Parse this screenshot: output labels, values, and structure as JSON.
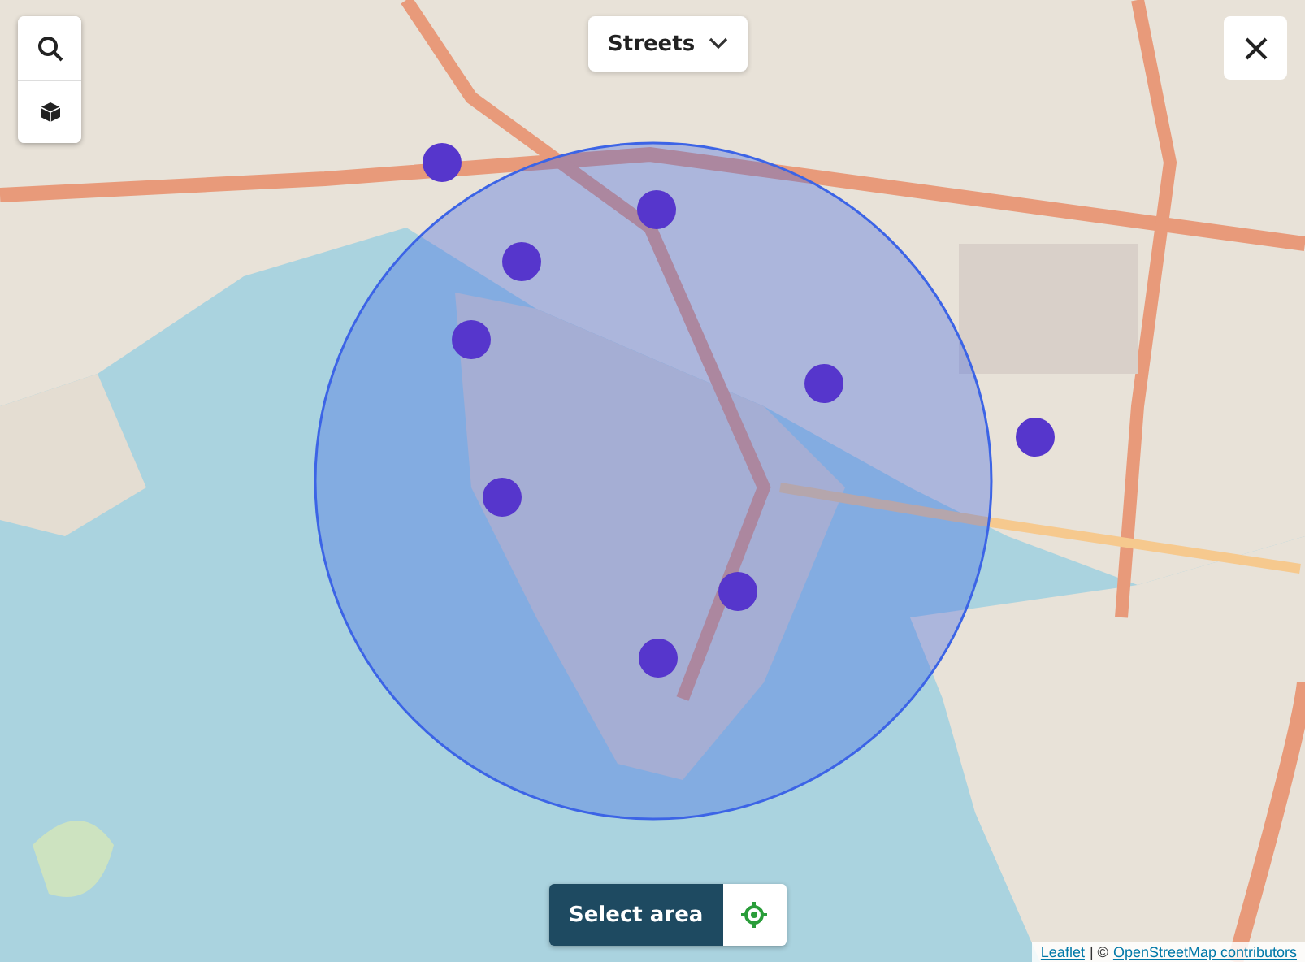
{
  "layer_switcher": {
    "label": "Streets"
  },
  "select_button": {
    "label": "Select area"
  },
  "attribution": {
    "leaflet": "Leaflet",
    "separator": "| ©",
    "osm": "OpenStreetMap contributors"
  }
}
